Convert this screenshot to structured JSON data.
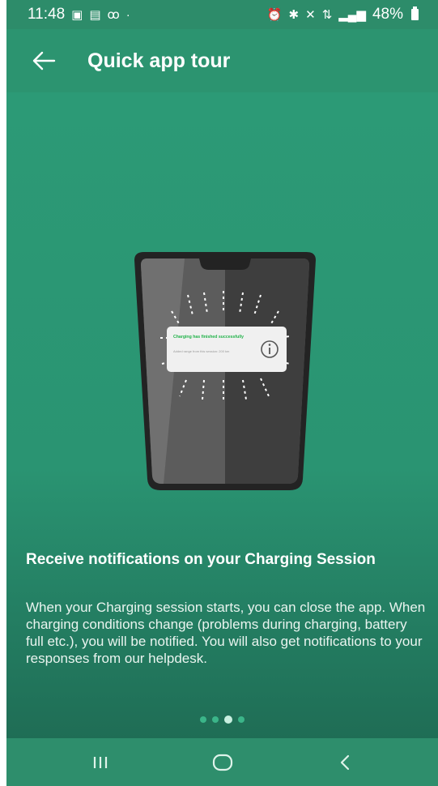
{
  "status_bar": {
    "time": "11:48",
    "battery": "48%",
    "left_icons": [
      "image-icon",
      "photo-icon",
      "voicemail-icon",
      "dot-icon"
    ],
    "right_icons": [
      "alarm-icon",
      "bluetooth-icon",
      "mute-icon",
      "data-icon",
      "signal-icon",
      "battery-icon"
    ]
  },
  "header": {
    "title": "Quick app tour"
  },
  "illustration": {
    "notification_title": "Charging has finished successfully",
    "notification_body": "Added range from this session: 200 km"
  },
  "content": {
    "headline": "Receive notifications on your Charging Session",
    "body": "When your Charging session starts, you can close the app. When charging conditions change (problems during charging, battery full etc.), you will be notified. You will also get notifications to your responses from our helpdesk."
  },
  "pager": {
    "count": 4,
    "active_index": 2
  },
  "nav": {
    "buttons": [
      "recent-apps-icon",
      "home-icon",
      "back-icon"
    ]
  },
  "colors": {
    "accent": "#2c9470",
    "status_bar": "#2d8c6a",
    "notification_title": "#22b34a"
  }
}
